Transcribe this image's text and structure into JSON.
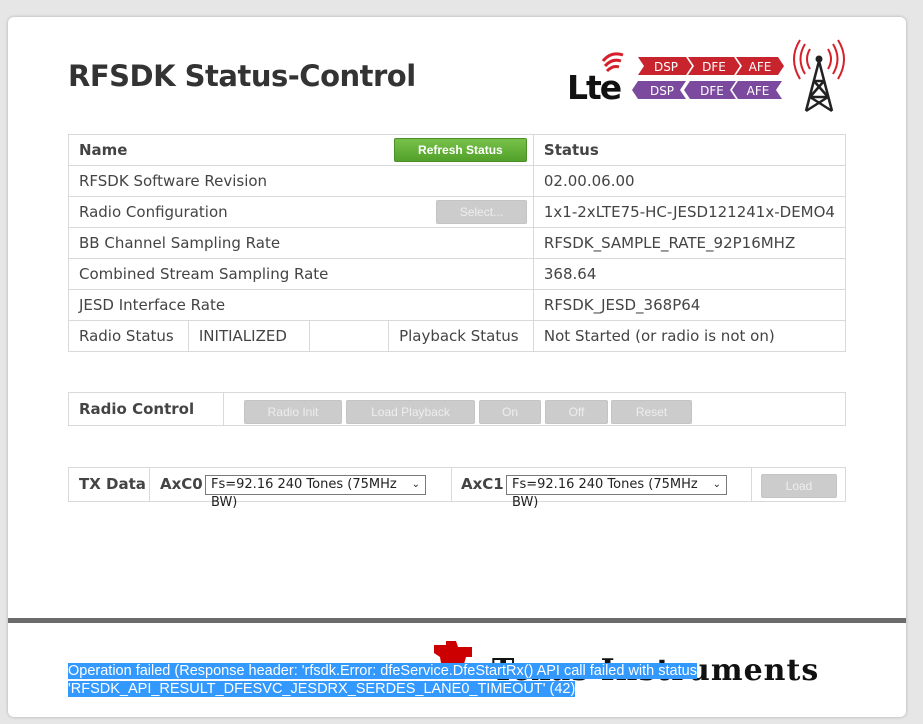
{
  "page": {
    "title": "RFSDK Status-Control"
  },
  "logos": {
    "lte_text": "Lte",
    "chevrons_top": [
      "DSP",
      "DFE",
      "AFE"
    ],
    "chevrons_bottom": [
      "DSP",
      "DFE",
      "AFE"
    ],
    "brand_colors": {
      "lte_red": "#d4202a",
      "chevron_red": "#c8242d",
      "chevron_purple": "#7b4a9e"
    }
  },
  "status_table": {
    "header_name": "Name",
    "header_status": "Status",
    "refresh_label": "Refresh Status",
    "select_label": "Select...",
    "rows": [
      {
        "name": "RFSDK Software Revision",
        "value": "02.00.06.00"
      },
      {
        "name": "Radio Configuration",
        "value": "1x1-2xLTE75-HC-JESD121241x-DEMO4"
      },
      {
        "name": "BB Channel Sampling Rate",
        "value": "RFSDK_SAMPLE_RATE_92P16MHZ"
      },
      {
        "name": "Combined Stream Sampling Rate",
        "value": "368.64"
      },
      {
        "name": "JESD Interface Rate",
        "value": "RFSDK_JESD_368P64"
      }
    ],
    "radio_status_label": "Radio Status",
    "radio_status_value": "INITIALIZED",
    "playback_status_label": "Playback Status",
    "playback_status_value": "Not Started (or radio is not on)"
  },
  "radio_control": {
    "label": "Radio Control",
    "buttons": [
      "Radio Init",
      "Load Playback",
      "On",
      "Off",
      "Reset"
    ]
  },
  "tx_data": {
    "label": "TX Data",
    "axc0_label": "AxC0",
    "axc0_value": "Fs=92.16 240 Tones (75MHz BW)",
    "axc1_label": "AxC1",
    "axc1_value": "Fs=92.16 240 Tones (75MHz BW)",
    "load_label": "Load"
  },
  "footer": {
    "ti_wordmark": "Texas Instruments",
    "error_message": "Operation failed (Response header: 'rfsdk.Error: dfeService.DfeStartRx() API call failed with status 'RFSDK_API_RESULT_DFESVC_JESDRX_SERDES_LANE0_TIMEOUT' (42)"
  }
}
